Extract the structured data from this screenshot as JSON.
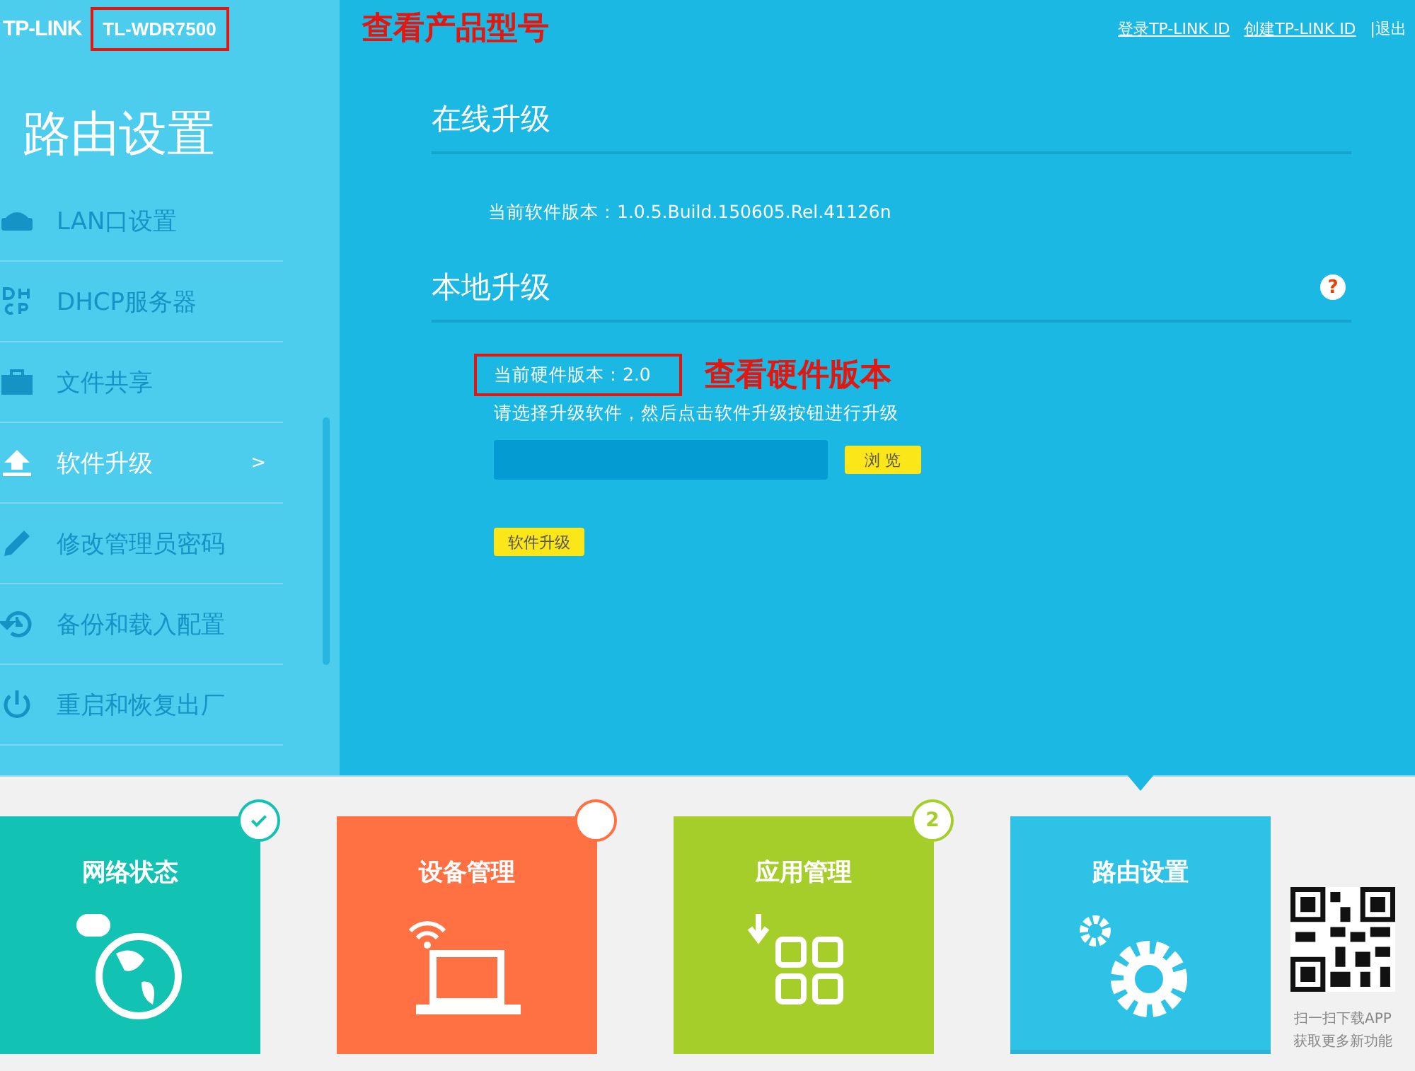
{
  "header": {
    "logo": "TP-LINK",
    "model": "TL-WDR7500",
    "model_note": "查看产品型号",
    "links": [
      "登录TP-LINK ID",
      "创建TP-LINK ID",
      "|退出"
    ]
  },
  "sidebar": {
    "title": "路由设置",
    "items": [
      {
        "label": "LAN口设置",
        "selected": false
      },
      {
        "label": "DHCP服务器",
        "selected": false
      },
      {
        "label": "文件共享",
        "selected": false
      },
      {
        "label": "软件升级",
        "selected": true,
        "arrow": ">"
      },
      {
        "label": "修改管理员密码",
        "selected": false
      },
      {
        "label": "备份和载入配置",
        "selected": false
      },
      {
        "label": "重启和恢复出厂",
        "selected": false
      }
    ]
  },
  "online": {
    "title": "在线升级",
    "software_version": "当前软件版本：1.0.5.Build.150605.Rel.41126n"
  },
  "local": {
    "title": "本地升级",
    "help": "?",
    "hardware_version": "当前硬件版本：2.0",
    "hardware_note": "查看硬件版本",
    "hint": "请选择升级软件，然后点击软件升级按钮进行升级",
    "browse": "浏 览",
    "upgrade": "软件升级"
  },
  "tiles": [
    {
      "label": "网络状态",
      "kind": "check",
      "color": "#12c3b3",
      "selected": false
    },
    {
      "label": "设备管理",
      "kind": "empty",
      "color": "#ff7043",
      "selected": false
    },
    {
      "label": "应用管理",
      "kind": "count",
      "count": "2",
      "color": "#a6ce2a",
      "selected": false
    },
    {
      "label": "路由设置",
      "kind": "none",
      "color": "#2ec3e6",
      "selected": true
    }
  ],
  "qr": {
    "caption": [
      "扫一扫下载APP",
      "获取更多新功能"
    ]
  }
}
